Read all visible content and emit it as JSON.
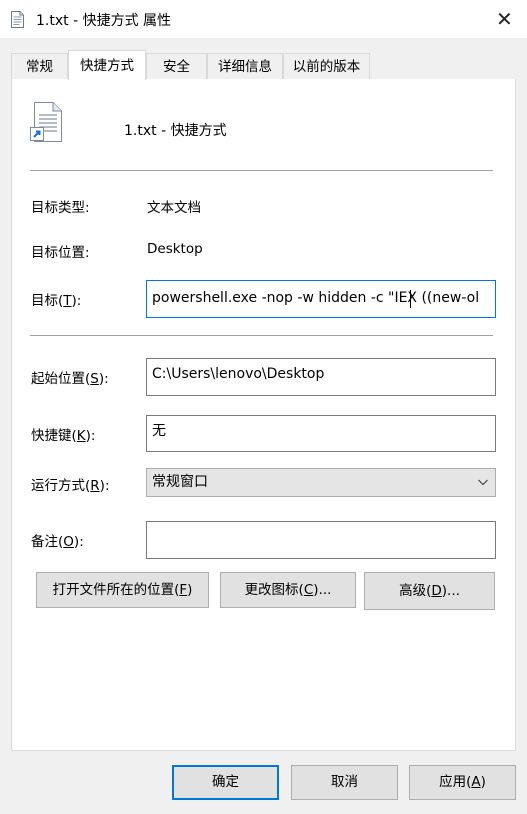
{
  "window": {
    "title": "1.txt - 快捷方式 属性",
    "close_glyph": "✕"
  },
  "tabs": [
    {
      "label": "常规",
      "active": false
    },
    {
      "label": "快捷方式",
      "active": true
    },
    {
      "label": "安全",
      "active": false
    },
    {
      "label": "详细信息",
      "active": false
    },
    {
      "label": "以前的版本",
      "active": false
    }
  ],
  "shortcut": {
    "name": "1.txt - 快捷方式",
    "target_type_label": "目标类型:",
    "target_type_value": "文本文档",
    "target_location_label": "目标位置:",
    "target_location_value": "Desktop",
    "target_label_pre": "目标(",
    "target_label_key": "T",
    "target_label_post": "):",
    "target_value": "powershell.exe -nop -w hidden -c \"IEX ((new-ol",
    "start_in_label_pre": "起始位置(",
    "start_in_label_key": "S",
    "start_in_label_post": "):",
    "start_in_value": "C:\\Users\\lenovo\\Desktop",
    "hotkey_label_pre": "快捷键(",
    "hotkey_label_key": "K",
    "hotkey_label_post": "):",
    "hotkey_value": "无",
    "run_label_pre": "运行方式(",
    "run_label_key": "R",
    "run_label_post": "):",
    "run_value": "常规窗口",
    "comment_label_pre": "备注(",
    "comment_label_key": "O",
    "comment_label_post": "):",
    "comment_value": ""
  },
  "actions": {
    "open_location_pre": "打开文件所在的位置(",
    "open_location_key": "F",
    "open_location_post": ")",
    "change_icon_pre": "更改图标(",
    "change_icon_key": "C",
    "change_icon_post": ")...",
    "advanced_pre": "高级(",
    "advanced_key": "D",
    "advanced_post": ")..."
  },
  "footer": {
    "ok": "确定",
    "cancel": "取消",
    "apply_pre": "应用(",
    "apply_key": "A",
    "apply_post": ")"
  },
  "colors": {
    "accent": "#0078d7",
    "window_bg": "#f0f0f0",
    "panel_bg": "#ffffff",
    "button_bg": "#e1e1e1"
  },
  "icons": {
    "title": "text-file-icon",
    "shortcut": "text-file-shortcut-icon",
    "close": "close-icon",
    "combo": "chevron-down-icon"
  }
}
